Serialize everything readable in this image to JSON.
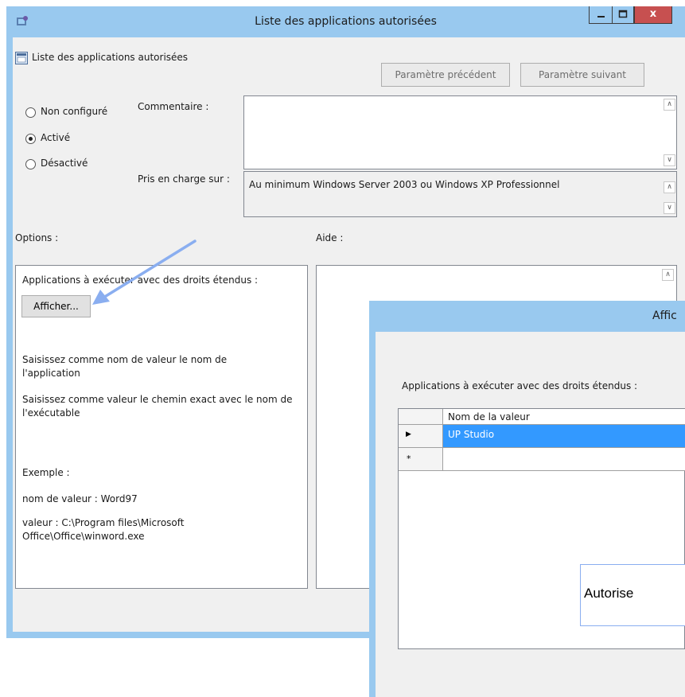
{
  "main_window": {
    "title": "Liste des applications autorisées",
    "policy_name": "Liste des applications autorisées",
    "buttons": {
      "minimize": "–",
      "maximize": "□",
      "close": "x",
      "previous_setting": "Paramètre précédent",
      "next_setting": "Paramètre suivant"
    },
    "radio_options": [
      {
        "label": "Non configuré",
        "checked": false
      },
      {
        "label": "Activé",
        "checked": true
      },
      {
        "label": "Désactivé",
        "checked": false
      }
    ],
    "comment_label": "Commentaire :",
    "comment_value": "",
    "supported_on_label": "Pris en charge sur :",
    "supported_on_value": "Au minimum Windows Server 2003 ou Windows XP Professionnel",
    "options_label": "Options :",
    "help_label": "Aide :",
    "options_panel": {
      "heading": "Applications à exécuter avec des droits étendus :",
      "show_button": "Afficher...",
      "instruction_1": "Saisissez comme nom de valeur le nom de l'application",
      "instruction_2": "Saisissez comme valeur le chemin exact avec le nom de l'exécutable",
      "example_label": "Exemple :",
      "example_name": "nom de valeur : Word97",
      "example_value": "valeur : C:\\Program files\\Microsoft Office\\Office\\winword.exe"
    },
    "help_panel_text": ""
  },
  "afficher_window": {
    "title": "Affic",
    "heading": "Applications à exécuter avec des droits étendus :",
    "grid": {
      "column_header": "Nom de la valeur",
      "rows": [
        {
          "indicator": "▶",
          "value": "UP Studio",
          "selected": true
        },
        {
          "indicator": "*",
          "value": "",
          "selected": false
        }
      ]
    },
    "tooltip_text": "Autorise"
  },
  "colors": {
    "titlebar": "#99c9ef",
    "client": "#f0f0f0",
    "close_button": "#c75050",
    "selection": "#3399ff",
    "annotation_arrow": "#8aaef0"
  },
  "icons": [
    "policy-icon",
    "app-icon",
    "minimize-icon",
    "maximize-icon",
    "close-icon",
    "row-pointer-icon",
    "new-row-icon"
  ]
}
